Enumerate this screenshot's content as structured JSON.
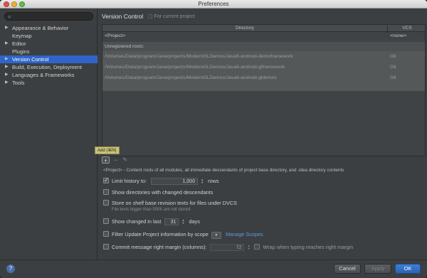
{
  "window": {
    "title": "Preferences"
  },
  "sidebar": {
    "search_placeholder": "",
    "items": [
      {
        "label": "Appearance & Behavior",
        "expandable": true
      },
      {
        "label": "Keymap",
        "expandable": false
      },
      {
        "label": "Editor",
        "expandable": true
      },
      {
        "label": "Plugins",
        "expandable": false
      },
      {
        "label": "Version Control",
        "expandable": true,
        "selected": true
      },
      {
        "label": "Build, Execution, Deployment",
        "expandable": true
      },
      {
        "label": "Languages & Frameworks",
        "expandable": true
      },
      {
        "label": "Tools",
        "expandable": true
      }
    ]
  },
  "main": {
    "title": "Version Control",
    "scope_note": "For current project",
    "table": {
      "col_directory": "Directory",
      "col_vcs": "VCS",
      "project_row": {
        "dir": "<Project>",
        "vcs": "<none>"
      },
      "unregistered_label": "Unregistered roots:",
      "unregistered": [
        {
          "dir": "/Volumes/Data/program/Java/projects/ModernGLDemos/Java6-android-demoframework",
          "vcs": "Git"
        },
        {
          "dir": "/Volumes/Data/program/Java/projects/ModernGLDemos/Java6-android-glframework",
          "vcs": "Git"
        },
        {
          "dir": "/Volumes/Data/program/Java/projects/ModernGLDemos/Java6-android-gldemos",
          "vcs": "Git"
        }
      ]
    },
    "toolbar": {
      "add_tooltip": "Add (⌘N)",
      "add": "+",
      "remove": "−",
      "edit": "✎"
    },
    "project_note": "<Project> - Content roots of all modules, all immediate descendants of project base directory, and .idea directory contents",
    "options": {
      "limit_history": {
        "label": "Limit history to:",
        "value": "1,000",
        "unit": "rows",
        "checked": true
      },
      "show_dirs": {
        "label": "Show directories with changed descendants",
        "checked": false
      },
      "store_shelf": {
        "label": "Store on shelf base revision texts for files under DVCS",
        "checked": false,
        "note": "File texts bigger than 500K are not stored"
      },
      "show_changed": {
        "label": "Show changed in last",
        "value": "31",
        "unit": "days",
        "checked": false
      },
      "filter_update": {
        "label": "Filter Update Project information by scope",
        "link": "Manage Scopes",
        "checked": false
      },
      "commit_margin": {
        "label": "Commit message right margin (columns):",
        "value": "72",
        "wrap_label": "Wrap when typing reaches right margin",
        "checked": false,
        "wrap_checked": false
      }
    }
  },
  "footer": {
    "help": "?",
    "cancel": "Cancel",
    "apply": "Apply",
    "ok": "OK"
  },
  "colors": {
    "accent": "#2f65ca",
    "link": "#5a9bdd",
    "background": "#3c3f41"
  }
}
